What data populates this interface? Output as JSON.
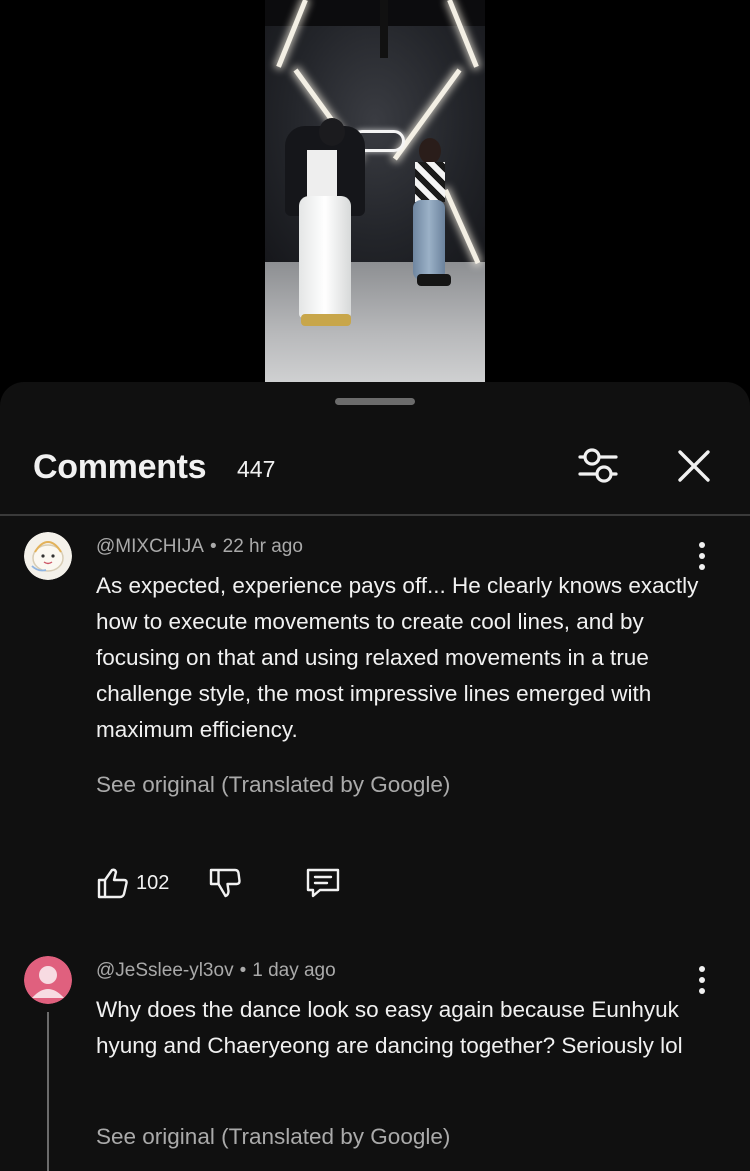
{
  "header": {
    "title": "Comments",
    "count": "447"
  },
  "comments": [
    {
      "author": "@MIXCHIJA",
      "time": "22 hr ago",
      "text": "As expected, experience pays off... He clearly knows exactly how to execute movements to create cool lines, and by focusing on that and using relaxed movements in a true challenge style, the most impressive lines emerged with maximum efficiency.",
      "translate_label": "See original (Translated by Google)",
      "likes": "102"
    },
    {
      "author": "@JeSslee-yl3ov",
      "time": "1 day ago",
      "text": "Why does the dance look so easy again because Eunhyuk hyung and Chaeryeong are dancing together? Seriously lol",
      "translate_label": "See original (Translated by Google)"
    }
  ],
  "separator": "•",
  "icons": {
    "filter": "filter-sliders-icon",
    "close": "close-icon",
    "more": "more-vertical-icon",
    "like": "thumbs-up-icon",
    "dislike": "thumbs-down-icon",
    "reply": "reply-comment-icon"
  },
  "colors": {
    "sheet_background": "#101010",
    "text_primary": "#f1f1f1",
    "text_secondary": "#aaaaaa",
    "avatar_pink": "#e0607e"
  }
}
